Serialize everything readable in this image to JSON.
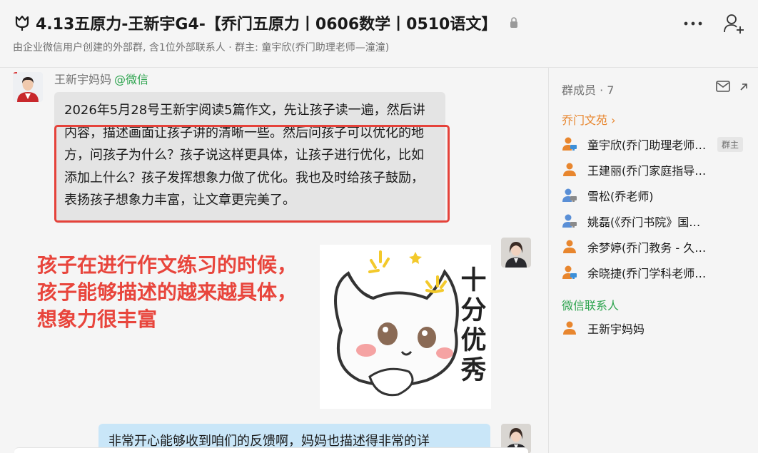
{
  "header": {
    "title": "4.13五原力-王新宇G4-【乔门五原力丨0606数学丨0510语文】",
    "subtitle": "由企业微信用户创建的外部群, 含1位外部联系人 · 群主: 童宇欣(乔门助理老师—潼潼)"
  },
  "messages": {
    "first": {
      "sender": "王新宇妈妈",
      "source": "@微信",
      "text": "2026年5月28号王新宇阅读5篇作文，先让孩子读一遍，然后讲内容，描述画面让孩子讲的清晰一些。然后问孩子可以优化的地方，问孩子为什么？孩子说这样更具体，让孩子进行优化，比如添加上什么？孩子发挥想象力做了优化。我也及时给孩子鼓励，表扬孩子想象力丰富，让文章更完美了。"
    },
    "annotation": "孩子在进行作文练习的时候，\n孩子能够描述的越来越具体，\n想象力很丰富",
    "sticker_text": "十分优秀",
    "second": {
      "text": "非常开心能够收到咱们的反馈啊，妈妈也描述得非常的详"
    }
  },
  "sidebar": {
    "members_title": "群成员 · 7",
    "section_qimen": "乔门文苑 ›",
    "section_wx": "微信联系人",
    "owner_badge": "群主",
    "members": [
      {
        "name": "童宇欣(乔门助理老师—潼潼)",
        "icon": "person-computer-icon"
      },
      {
        "name": "王建丽(乔门家庭指导师—丽丽)",
        "icon": "person-icon"
      },
      {
        "name": "雪松(乔老师)",
        "icon": "person-computer-icon"
      },
      {
        "name": "姚磊(《乔门书院》国家队...",
        "icon": "person-computer-icon"
      },
      {
        "name": "余梦婷(乔门教务 - 久久老师)",
        "icon": "person-icon"
      },
      {
        "name": "余晓捷(乔门学科老师——晓捷)",
        "icon": "person-computer-icon"
      }
    ],
    "wx_members": [
      {
        "name": "王新宇妈妈",
        "icon": "person-icon"
      }
    ]
  },
  "colors": {
    "accent_orange": "#e8862e",
    "wechat_green": "#2ea44f",
    "annotation_red": "#e8453c"
  }
}
